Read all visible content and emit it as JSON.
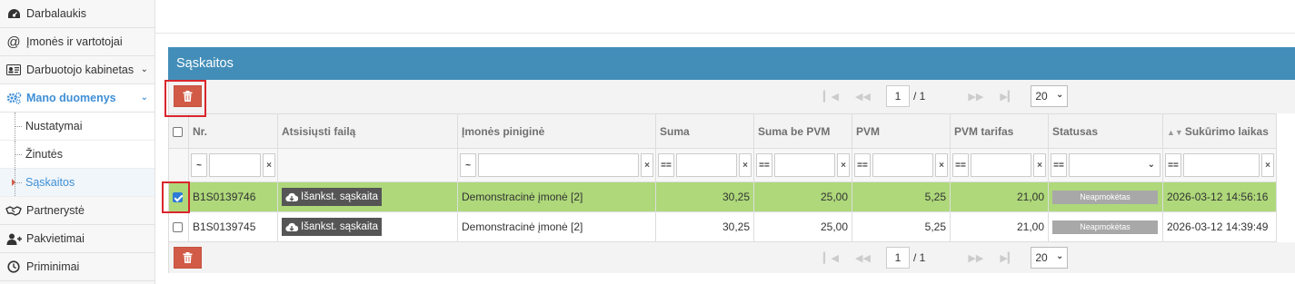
{
  "sidebar": {
    "items": [
      {
        "label": "Darbalaukis",
        "icon": "dashboard-icon"
      },
      {
        "label": "Įmonės ir vartotojai",
        "icon": "at-icon"
      },
      {
        "label": "Darbuotojo kabinetas",
        "icon": "id-card-icon"
      },
      {
        "label": "Mano duomenys",
        "icon": "gears-icon"
      },
      {
        "label": "Partnerystė",
        "icon": "handshake-icon"
      },
      {
        "label": "Pakvietimai",
        "icon": "user-plus-icon"
      },
      {
        "label": "Priminimai",
        "icon": "clock-icon"
      }
    ],
    "subitems": [
      {
        "label": "Nustatymai"
      },
      {
        "label": "Žinutės"
      },
      {
        "label": "Sąskaitos"
      }
    ]
  },
  "panel": {
    "title": "Sąskaitos"
  },
  "pager": {
    "page": "1",
    "total": "/ 1",
    "page_size": "20"
  },
  "table": {
    "columns": [
      "Nr.",
      "Atsisiųsti failą",
      "Įmonės piniginė",
      "Suma",
      "Suma be PVM",
      "PVM",
      "PVM tarifas",
      "Statusas",
      "Sukūrimo laikas"
    ],
    "filter_ops": {
      "text": "~",
      "num": "==",
      "clear": "×"
    },
    "rows": [
      {
        "nr": "B1S0139746",
        "file": "Išankst. sąskaita",
        "wallet": "Demonstracinė įmonė [2]",
        "suma": "30,25",
        "suma_be_pvm": "25,00",
        "pvm": "5,25",
        "tarifas": "21,00",
        "status": "Neapmokėtas",
        "created": "2026-03-12 14:56:16",
        "checked": true
      },
      {
        "nr": "B1S0139745",
        "file": "Išankst. sąskaita",
        "wallet": "Demonstracinė įmonė [2]",
        "suma": "30,25",
        "suma_be_pvm": "25,00",
        "pvm": "5,25",
        "tarifas": "21,00",
        "status": "Neapmokėtas",
        "created": "2026-03-12 14:39:49",
        "checked": false
      }
    ]
  },
  "colors": {
    "header_blue": "#438eb9",
    "delete_red": "#d15b47",
    "highlight_red": "#d9262c",
    "selected_row": "#aed87a",
    "active_nav": "#3e8fd6"
  }
}
